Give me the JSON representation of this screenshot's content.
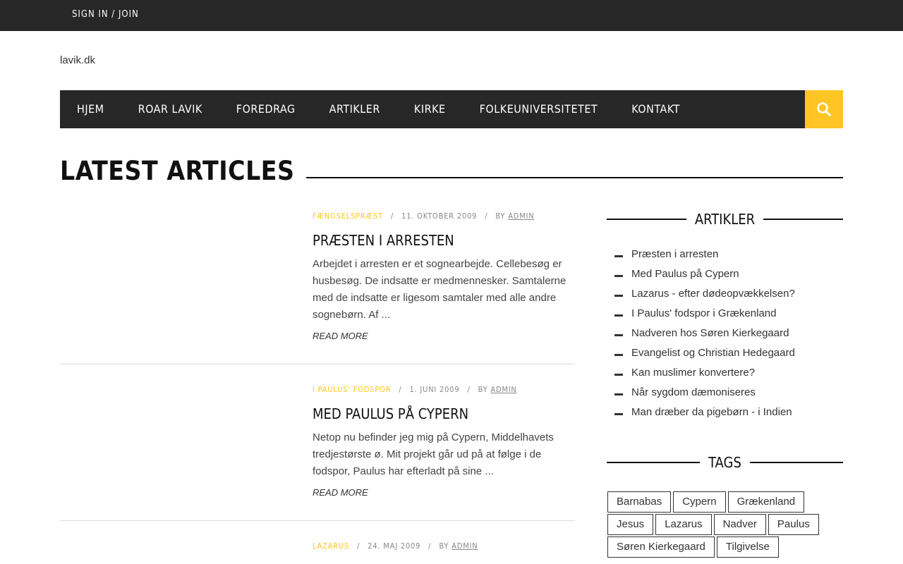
{
  "topbar": {
    "signin_label": "SIGN IN / JOIN"
  },
  "site": {
    "name": "lavik.dk"
  },
  "nav": {
    "items": [
      "HJEM",
      "ROAR LAVIK",
      "FOREDRAG",
      "ARTIKLER",
      "KIRKE",
      "FOLKEUNIVERSITETET",
      "KONTAKT"
    ],
    "search_icon": "search-icon",
    "accent": "#fec524"
  },
  "main": {
    "section_title": "LATEST ARTICLES",
    "articles": [
      {
        "category": "FÆNGSELSPRÆST",
        "date": "11. OKTOBER 2009",
        "by": "BY",
        "author": "ADMIN",
        "title": "PRÆSTEN I ARRESTEN",
        "excerpt": "Arbejdet i arresten er et sognearbejde. Cellebesøg er husbesøg. De indsatte er medmennesker. Samtalerne med de indsatte er ligesom samtaler med alle andre sognebørn. Af ...",
        "readmore": "READ MORE"
      },
      {
        "category": "I PAULUS' FODSPOR",
        "date": "1. JUNI 2009",
        "by": "BY",
        "author": "ADMIN",
        "title": "MED PAULUS PÅ CYPERN",
        "excerpt": "Netop nu befinder jeg mig på Cypern, Middelhavets tredjestørste ø. Mit projekt går ud på at følge i de fodspor, Paulus har efterladt på sine ...",
        "readmore": "READ MORE"
      },
      {
        "category": "LAZARUS",
        "date": "24. MAJ 2009",
        "by": "BY",
        "author": "ADMIN"
      }
    ]
  },
  "sidebar": {
    "artikler_title": "ARTIKLER",
    "artikler": [
      "Præsten i arresten",
      "Med Paulus på Cypern",
      "Lazarus - efter dødeopvækkelsen?",
      "I Paulus' fodspor i Grækenland",
      "Nadveren hos Søren Kierkegaard",
      "Evangelist og Christian Hedegaard",
      "Kan muslimer konvertere?",
      "Når sygdom dæmoniseres",
      "Man dræber da pigebørn - i Indien"
    ],
    "tags_title": "TAGS",
    "tags": [
      "Barnabas",
      "Cypern",
      "Grækenland",
      "Jesus",
      "Lazarus",
      "Nadver",
      "Paulus",
      "Søren Kierkegaard",
      "Tilgivelse"
    ]
  }
}
